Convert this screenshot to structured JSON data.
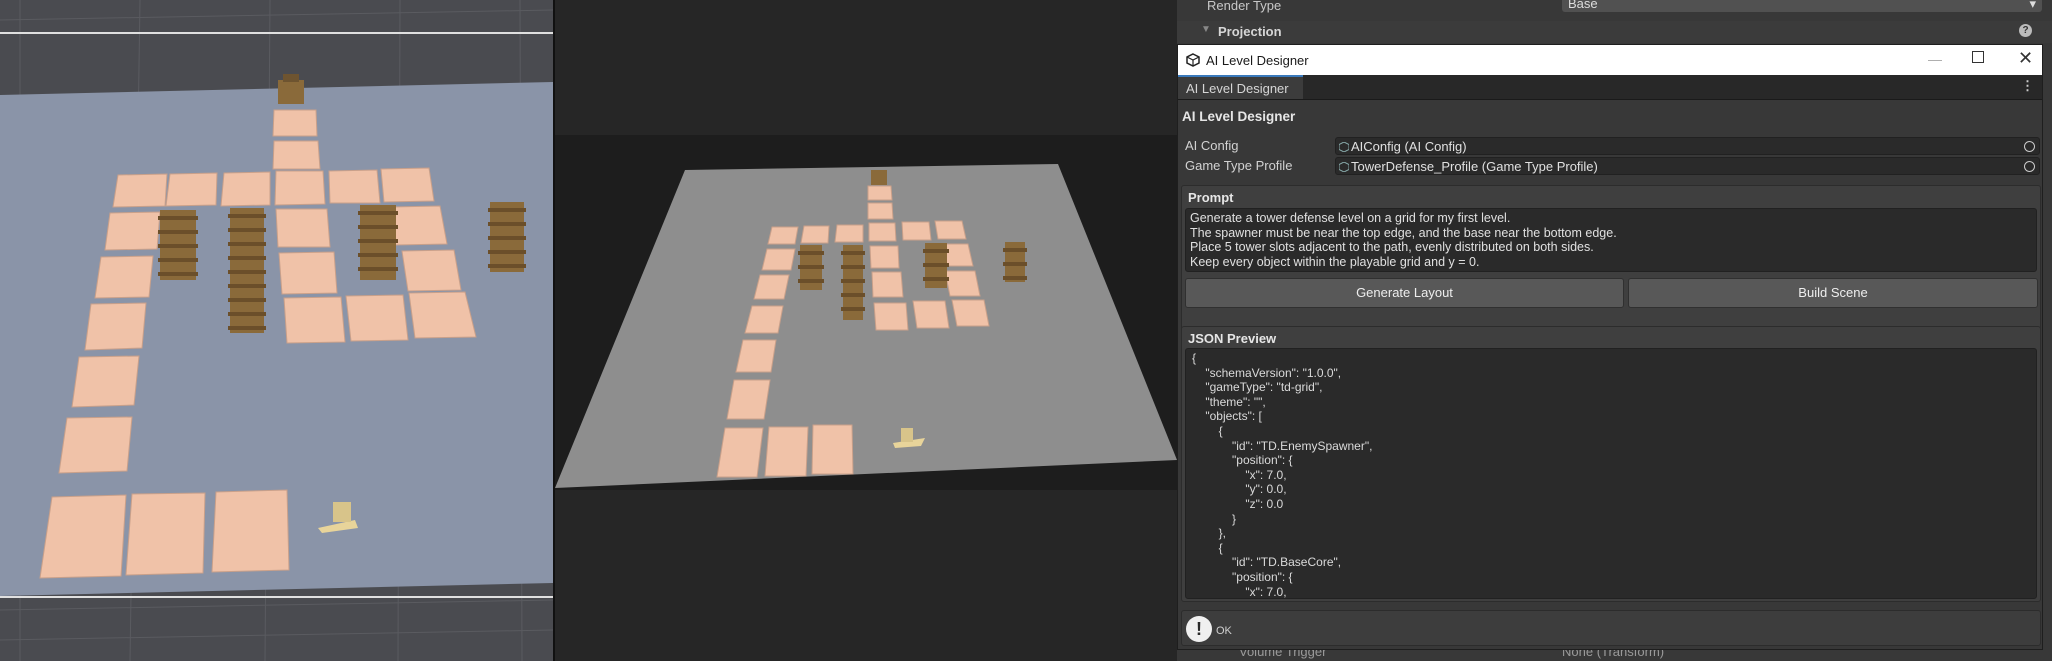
{
  "inspector": {
    "render_type_label": "Render Type",
    "render_type_value": "Base",
    "projection_label": "Projection",
    "volume_trigger_label": "Volume Trigger",
    "volume_trigger_value": "None (Transform)"
  },
  "window": {
    "title": "AI Level Designer",
    "tab_label": "AI Level Designer",
    "heading": "AI Level Designer"
  },
  "fields": {
    "ai_config_label": "AI Config",
    "ai_config_value": "AIConfig (AI Config)",
    "game_type_label": "Game Type Profile",
    "game_type_value": "TowerDefense_Profile (Game Type Profile)"
  },
  "prompt": {
    "title": "Prompt",
    "text": "Generate a tower defense level on a grid for my first level.\nThe spawner must be near the top edge, and the base near the bottom edge.\nPlace 5 tower slots adjacent to the path, evenly distributed on both sides.\nKeep every object within the playable grid and y = 0."
  },
  "buttons": {
    "generate": "Generate Layout",
    "build": "Build Scene"
  },
  "json_preview": {
    "title": "JSON Preview",
    "text": "{\n    \"schemaVersion\": \"1.0.0\",\n    \"gameType\": \"td-grid\",\n    \"theme\": \"\",\n    \"objects\": [\n        {\n            \"id\": \"TD.EnemySpawner\",\n            \"position\": {\n                \"x\": 7.0,\n                \"y\": 0.0,\n                \"z\": 0.0\n            }\n        },\n        {\n            \"id\": \"TD.BaseCore\",\n            \"position\": {\n                \"x\": 7.0,"
  },
  "help": {
    "text": "OK"
  },
  "colors": {
    "tile": "#f0c2a8",
    "tower": "#8a6a3a",
    "ground_left": "#8a94a8",
    "ground_mid": "#8e8e8e",
    "accent_tab": "#3a79bb"
  }
}
